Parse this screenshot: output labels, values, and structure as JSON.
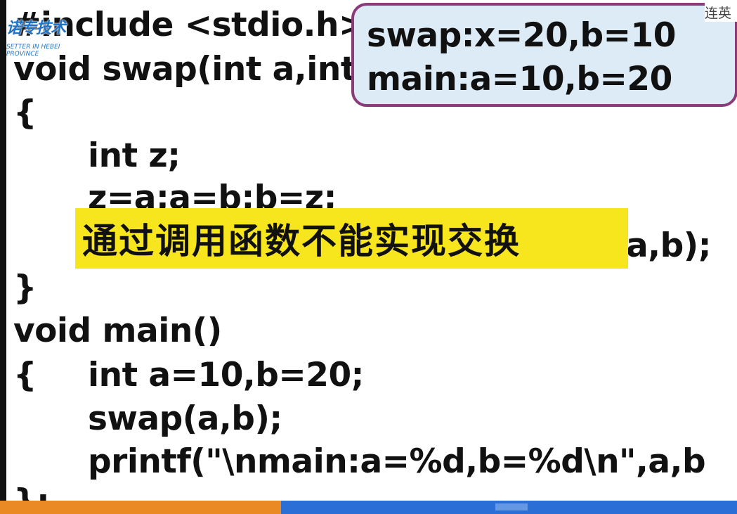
{
  "code": {
    "include": "#include <stdio.h>",
    "swap_header": "void swap(int a,int b)",
    "open_brace_1": "{",
    "decl_z": "int z;",
    "swap_stmt": "z=a;a=b;b=z;",
    "printf_partial": "a,b);",
    "close_brace_1": "}",
    "main_header": "void main()",
    "open_brace_2": "{",
    "decl_ab": "int a=10,b=20;",
    "call_swap": "swap(a,b);",
    "printf_main": "printf(\"\\nmain:a=%d,b=%d\\n\",a,b",
    "last_line": "};"
  },
  "output": {
    "line1": "swap:x=20,b=10",
    "line2": "main:a=10,b=20"
  },
  "subtitle": "通过调用函数不能实现交换",
  "logo": {
    "cn": "诺专技术",
    "en": "SETTER IN HEBEI PROVINCE"
  },
  "corner_text": "连英",
  "colors": {
    "subtitle_bg": "#f7e51d",
    "output_border": "#8b3b7a",
    "output_bg": "#dcebf5",
    "bottom_orange": "#e98a24",
    "bottom_blue": "#2b6fd6"
  }
}
